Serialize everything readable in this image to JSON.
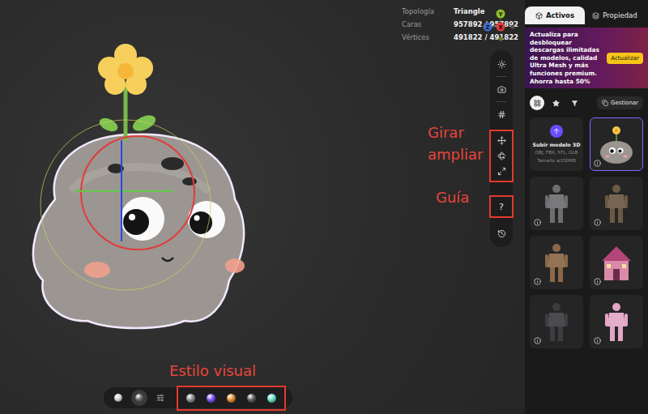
{
  "viewport": {
    "stats": [
      {
        "label": "Topología",
        "value": "Triangle"
      },
      {
        "label": "Caras",
        "value": "957892 / 957892"
      },
      {
        "label": "Vértices",
        "value": "491822 / 491822"
      }
    ],
    "gizmo": [
      {
        "axis": "Y",
        "color": "#8fbf2a"
      },
      {
        "axis": "Z",
        "color": "#3f6fd1"
      },
      {
        "axis": "X",
        "color": "#e23b3b"
      }
    ],
    "toolbar": [
      {
        "kind": "light",
        "annotated": false
      },
      {
        "kind": "camera",
        "annotated": false
      },
      {
        "kind": "adjust",
        "annotated": false
      },
      {
        "kind": "transform",
        "annotated": true
      },
      {
        "kind": "help",
        "label": "?",
        "annotated": true
      },
      {
        "kind": "reset",
        "annotated": false
      }
    ],
    "annotations": {
      "transform": [
        "Girar",
        "ampliar"
      ],
      "help": [
        "Guía"
      ],
      "style": [
        "Estilo visual"
      ]
    },
    "bottom_bar": {
      "shading": [
        {
          "kind": "lit",
          "selected": false
        },
        {
          "kind": "matcap",
          "selected": true
        }
      ],
      "materials_annotated": true,
      "materials": [
        {
          "color": "#8a8a8a",
          "selected": false
        },
        {
          "color": "#7b4dff",
          "selected": false
        },
        {
          "color": "#e08a2a",
          "selected": false
        },
        {
          "color": "#5a5a5a",
          "selected": false
        },
        {
          "color": "#5fe0c8",
          "selected": false
        }
      ]
    }
  },
  "panel": {
    "tabs": [
      {
        "label": "Activos",
        "selected": true
      },
      {
        "label": "Propiedad",
        "selected": false
      }
    ],
    "promo": {
      "text": "Actualiza para desbloquear descargas ilimitadas de modelos, calidad Ultra Mesh y más funciones premium.",
      "saving_label": "Ahorra hasta",
      "saving": "50%",
      "button": "Actualizar"
    },
    "filters": [
      {
        "kind": "all",
        "selected": true
      },
      {
        "kind": "favorites",
        "selected": false
      },
      {
        "kind": "filter",
        "selected": false
      }
    ],
    "manage": "Gestionar",
    "upload": {
      "title": "Subir modelo 3D",
      "formats": "OBJ, FBX, STL, GLB",
      "size": "Tamaño ≤150MB"
    },
    "models": [
      {
        "kind": "creature",
        "selected": true,
        "color": "#9a958f"
      },
      {
        "kind": "figure",
        "selected": false,
        "color": "#6e6e70"
      },
      {
        "kind": "figure",
        "selected": false,
        "color": "#6b5a45"
      },
      {
        "kind": "figure",
        "selected": false,
        "color": "#8a6848"
      },
      {
        "kind": "building",
        "selected": false,
        "color": "#d98aa8"
      },
      {
        "kind": "figure",
        "selected": false,
        "color": "#3e3c40"
      },
      {
        "kind": "figure",
        "selected": false,
        "color": "#e2a6c6"
      }
    ]
  }
}
